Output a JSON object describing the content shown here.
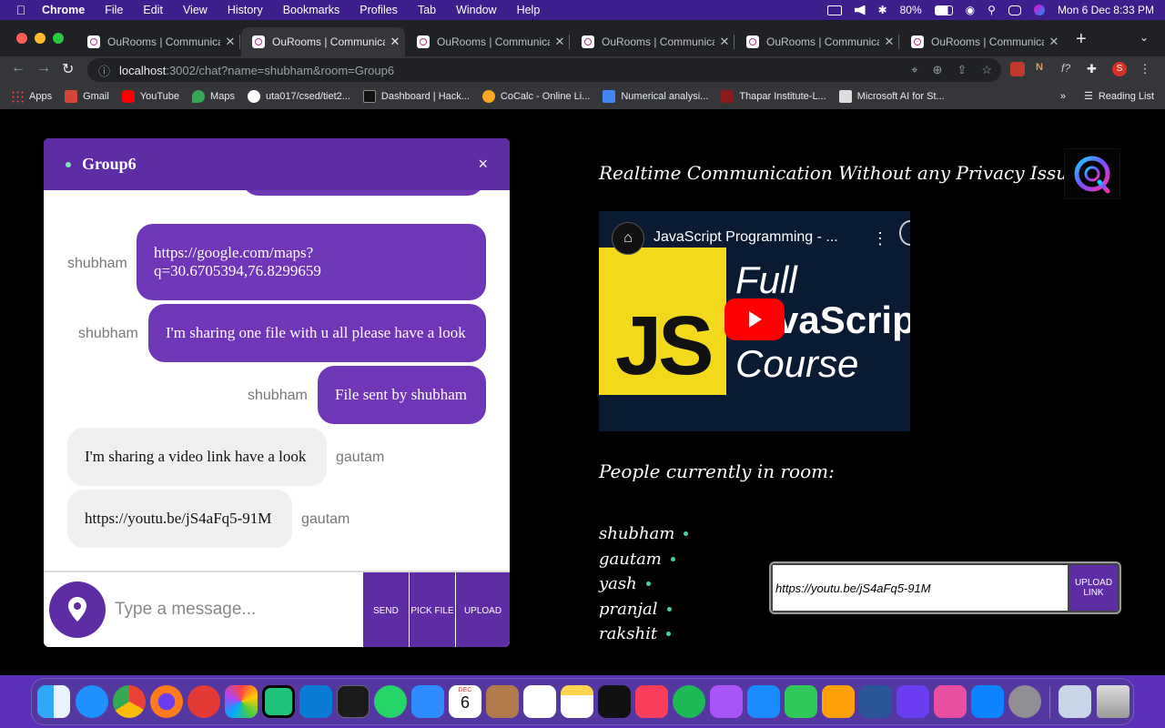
{
  "menubar": {
    "app": "Chrome",
    "items": [
      "File",
      "Edit",
      "View",
      "History",
      "Bookmarks",
      "Profiles",
      "Tab",
      "Window",
      "Help"
    ],
    "battery": "80%",
    "datetime": "Mon 6 Dec  8:33 PM"
  },
  "tabs": [
    {
      "title": "OuRooms | Communicati"
    },
    {
      "title": "OuRooms | Communicati"
    },
    {
      "title": "OuRooms | Communicati"
    },
    {
      "title": "OuRooms | Communicati"
    },
    {
      "title": "OuRooms | Communicati"
    },
    {
      "title": "OuRooms | Communicati"
    }
  ],
  "omnibox": {
    "host": "localhost",
    "rest": ":3002/chat?name=shubham&room=Group6"
  },
  "bookmarks": [
    "Apps",
    "Gmail",
    "YouTube",
    "Maps",
    "uta017/csed/tiet2...",
    "Dashboard | Hack...",
    "CoCalc - Online Li...",
    "Numerical analysi...",
    "Thapar Institute-L...",
    "Microsoft AI for St..."
  ],
  "reading_list": "Reading List",
  "chat": {
    "room": "Group6",
    "close": "×",
    "messages": [
      {
        "sender": "shubham",
        "text": "https://google.com/maps? q=30.6705394,76.8299659",
        "mine": true
      },
      {
        "sender": "shubham",
        "text": "I'm sharing one file with u all please have a look",
        "mine": true
      },
      {
        "sender": "shubham",
        "text": "File sent by shubham",
        "mine": true
      },
      {
        "sender": "gautam",
        "text": "I'm sharing a video link have a look",
        "mine": false
      },
      {
        "sender": "gautam",
        "text": "https://youtu.be/jS4aFq5-91M",
        "mine": false
      }
    ],
    "placeholder": "Type a message...",
    "send": "SEND",
    "pick_file": "PICK FILE",
    "upload": "UPLOAD"
  },
  "side": {
    "tagline": "Realtime Communication Without any Privacy Issues",
    "video": {
      "title": "JavaScript Programming - ...",
      "thumb_big": "JS",
      "thumb_line1": "Full",
      "thumb_line2": "vaScrip",
      "thumb_line3": "Course"
    },
    "people_heading": "People currently in room:",
    "people": [
      "shubham",
      "gautam",
      "yash",
      "pranjal",
      "rakshit"
    ],
    "upload_value": "https://youtu.be/jS4aFq5-91M",
    "upload_btn": "UPLOAD LINK"
  },
  "dock_date": "6",
  "dock_month": "DEC"
}
